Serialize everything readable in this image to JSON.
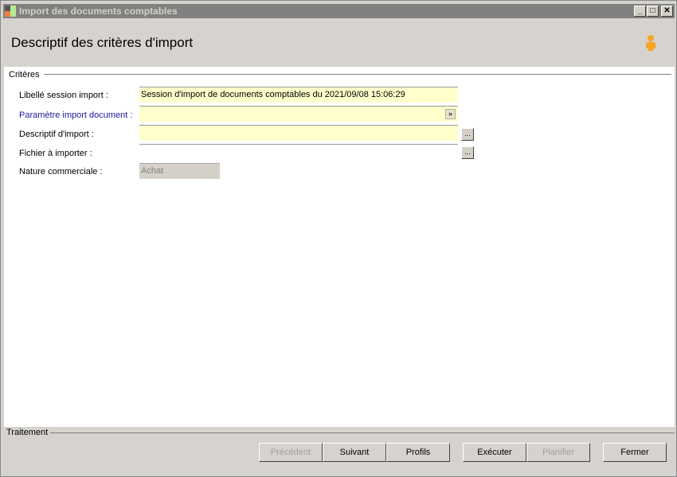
{
  "window": {
    "title": "Import des documents comptables",
    "minimize": "_",
    "maximize": "□",
    "close": "✕"
  },
  "header": {
    "title": "Descriptif des critères d'import"
  },
  "criteria": {
    "legend": "Critères",
    "session_label": "Libellé session import :",
    "session_value": "Session d'import de documents comptables du 2021/09/08 15:06:29",
    "param_label": "Paramètre import document :",
    "param_value": "",
    "descriptif_label": "Descriptif d'import :",
    "descriptif_value": "",
    "fichier_label": "Fichier à importer :",
    "fichier_value": "",
    "nature_label": "Nature commerciale :",
    "nature_value": "Achat",
    "browse": "..."
  },
  "footer": {
    "legend": "Traitement",
    "buttons": {
      "precedent": "Précédent",
      "suivant": "Suivant",
      "profils": "Profils",
      "executer": "Exécuter",
      "planifier": "Planifier",
      "fermer": "Fermer"
    }
  },
  "colors": {
    "required_bg": "#ffffcc",
    "link_label": "#1a1aa0"
  }
}
